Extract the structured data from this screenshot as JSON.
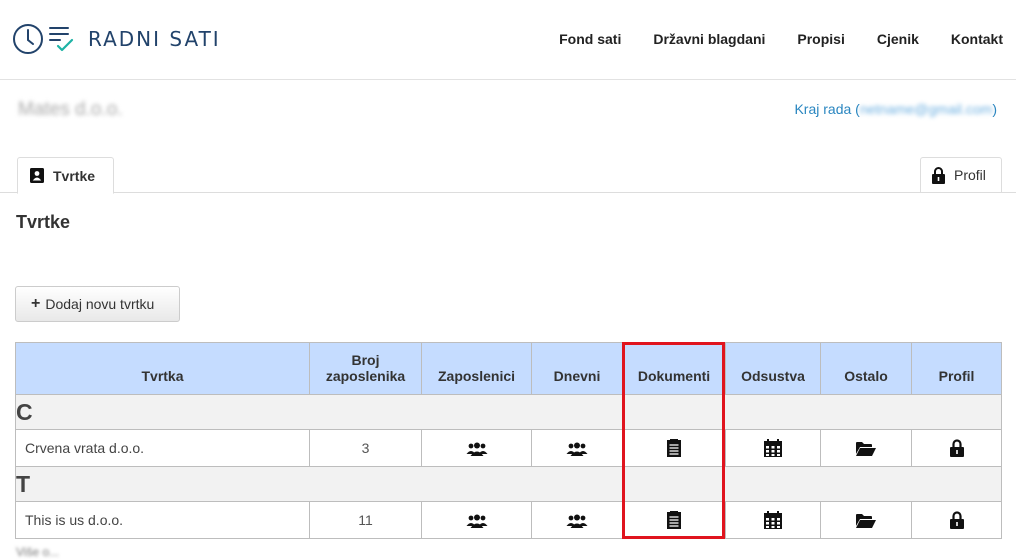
{
  "header": {
    "logo_text": "RADNI SATI",
    "nav": [
      "Fond sati",
      "Državni blagdani",
      "Propisi",
      "Cjenik",
      "Kontakt"
    ]
  },
  "company": {
    "name": "Mates d.o.o.",
    "logout_prefix": "Kraj rada (",
    "logout_email": "netname@gmail.com",
    "logout_suffix": ")"
  },
  "tabs": {
    "active": "Tvrtke",
    "profil": "Profil"
  },
  "main": {
    "title": "Tvrtke",
    "add_button": "Dodaj novu tvrtku",
    "more_link": "Više o..."
  },
  "table": {
    "headers": [
      "Tvrtka",
      "Broj zaposlenika",
      "Zaposlenici",
      "Dnevni",
      "Dokumenti",
      "Odsustva",
      "Ostalo",
      "Profil"
    ],
    "groups": [
      {
        "letter": "C",
        "rows": [
          {
            "name": "Crvena vrata d.o.o.",
            "count": "3"
          }
        ]
      },
      {
        "letter": "T",
        "rows": [
          {
            "name": "This is us d.o.o.",
            "count": "11"
          }
        ]
      }
    ]
  },
  "colors": {
    "header_bg": "#c5dcff",
    "link": "#2a86c0",
    "logo": "#22436b",
    "logo_accent": "#1eb3a5",
    "highlight": "#e0141e"
  },
  "icons": {
    "zaposlenici": "users-icon",
    "dnevni": "users-icon",
    "dokumenti": "document-icon",
    "odsustva": "calendar-icon",
    "ostalo": "folder-open-icon",
    "profil": "lock-icon"
  }
}
